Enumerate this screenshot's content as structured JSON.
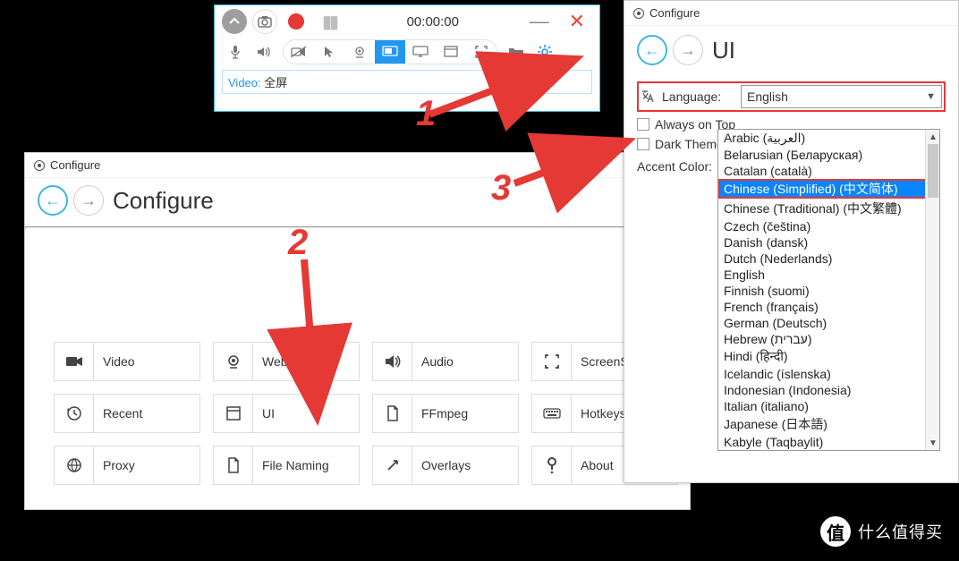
{
  "recorder": {
    "timer": "00:00:00",
    "video_label": "Video:",
    "video_value": "全屏"
  },
  "configure": {
    "window_title": "Configure",
    "heading": "Configure",
    "tiles": [
      {
        "label": "Video"
      },
      {
        "label": "Webcam"
      },
      {
        "label": "Audio"
      },
      {
        "label": "ScreenShot"
      },
      {
        "label": "Recent"
      },
      {
        "label": "UI"
      },
      {
        "label": "FFmpeg"
      },
      {
        "label": "Hotkeys"
      },
      {
        "label": "Proxy"
      },
      {
        "label": "File Naming"
      },
      {
        "label": "Overlays"
      },
      {
        "label": "About"
      }
    ]
  },
  "configure_ui": {
    "window_title": "Configure",
    "heading": "UI",
    "language_label": "Language:",
    "language_selected": "English",
    "always_on_top": "Always on Top",
    "dark_theme": "Dark Theme",
    "accent_color_label": "Accent Color:",
    "accent_color": "#2196f3",
    "options": [
      "Arabic (العربية)",
      "Belarusian (Беларуская)",
      "Catalan (català)",
      "Chinese (Simplified) (中文简体)",
      "Chinese (Traditional) (中文繁體)",
      "Czech (čeština)",
      "Danish (dansk)",
      "Dutch (Nederlands)",
      "English",
      "Finnish (suomi)",
      "French (français)",
      "German (Deutsch)",
      "Hebrew (עברית)",
      "Hindi (हिन्दी)",
      "Icelandic (íslenska)",
      "Indonesian (Indonesia)",
      "Italian (italiano)",
      "Japanese (日本語)",
      "Kabyle (Taqbaylit)"
    ],
    "highlighted_index": 3
  },
  "annotations": {
    "n1": "1",
    "n2": "2",
    "n3": "3"
  },
  "watermark": {
    "badge": "值",
    "text": "什么值得买"
  }
}
